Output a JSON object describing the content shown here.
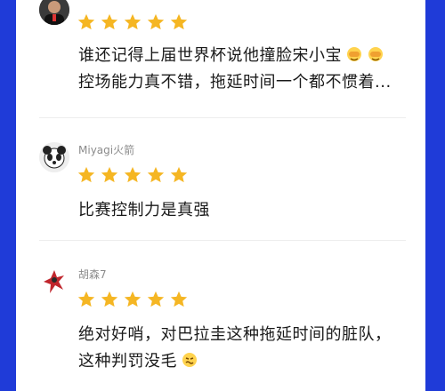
{
  "reviews": [
    {
      "username": "",
      "avatar_icon": "man-portrait-avatar",
      "rating": 5,
      "lines": [
        "谁还记得上届世界杯说他撞脸宋小宝",
        "控场能力真不错，拖延时间一个都不惯着..."
      ],
      "emojis": [
        "facepalm-emoji",
        "facepalm-emoji"
      ]
    },
    {
      "username": "Miyagi火箭",
      "avatar_icon": "panda-avatar",
      "rating": 5,
      "lines": [
        "比赛控制力是真强"
      ]
    },
    {
      "username": "胡森7",
      "avatar_icon": "red-figure-avatar",
      "rating": 5,
      "lines": [
        "绝对好哨，对巴拉圭这种拖延时间的脏队，",
        "这种判罚没毛"
      ],
      "emojis": [
        "grimace-emoji"
      ]
    }
  ],
  "colors": {
    "star": "#f5b623",
    "frame": "#1f3bd8",
    "text": "#1a1a1a",
    "username": "#8b8b8b"
  }
}
